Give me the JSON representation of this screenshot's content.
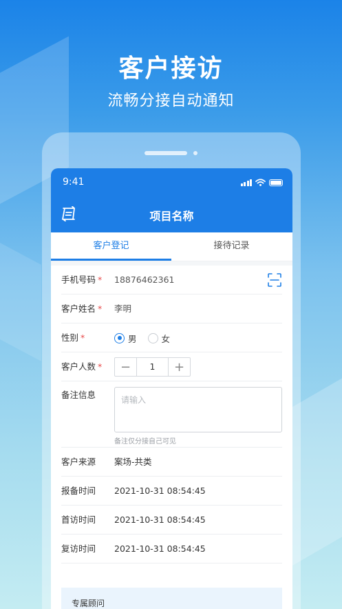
{
  "hero": {
    "title": "客户接访",
    "subtitle": "流畅分接自动通知"
  },
  "status_bar": {
    "time": "9:41"
  },
  "nav": {
    "title": "项目名称",
    "back_icon": "swap-list-icon"
  },
  "tabs": [
    {
      "label": "客户登记",
      "active": true
    },
    {
      "label": "接待记录",
      "active": false
    }
  ],
  "form": {
    "phone": {
      "label": "手机号码",
      "required_mark": "*",
      "value": "18876462361",
      "scan_icon": "scan-icon"
    },
    "name": {
      "label": "客户姓名",
      "required_mark": "*",
      "value": "李明"
    },
    "gender": {
      "label": "性别",
      "required_mark": "*",
      "options": [
        "男",
        "女"
      ],
      "selected": "男"
    },
    "count": {
      "label": "客户人数",
      "required_mark": "*",
      "value": "1",
      "minus": "−",
      "plus": "+"
    },
    "remark": {
      "label": "备注信息",
      "placeholder": "请输入",
      "hint": "备注仅分接自己可见"
    },
    "source": {
      "label": "客户来源",
      "value": "案场-共类"
    },
    "report_time": {
      "label": "报备时间",
      "value": "2021-10-31 08:54:45"
    },
    "first_visit": {
      "label": "首访时间",
      "value": "2021-10-31 08:54:45"
    },
    "revisit": {
      "label": "复访时间",
      "value": "2021-10-31 08:54:45"
    }
  },
  "advisor": {
    "label": "专属顾问"
  },
  "colors": {
    "primary": "#1d7ee6",
    "required": "#e84b4b"
  }
}
